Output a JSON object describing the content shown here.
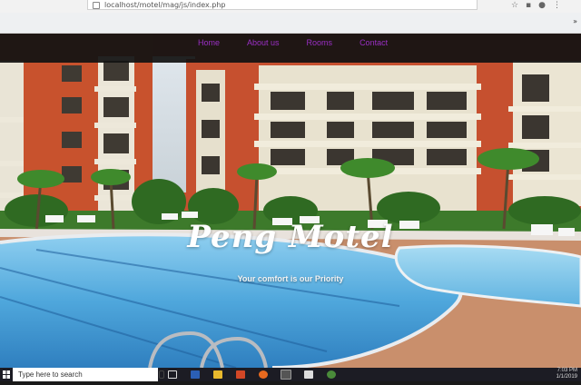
{
  "browser": {
    "address_url": "localhost/motel/mag/js/index.php",
    "bookmarks_more": "»"
  },
  "nav": {
    "links": [
      "Home",
      "About us",
      "Rooms",
      "Contact"
    ],
    "link_color": "#9a2fc4"
  },
  "hero": {
    "title": "Peng Motel",
    "tagline": "Your comfort is our Priority"
  },
  "taskbar": {
    "search_placeholder": "Type here to search",
    "clock_time": "7:03 PM",
    "clock_date": "1/1/2019"
  }
}
